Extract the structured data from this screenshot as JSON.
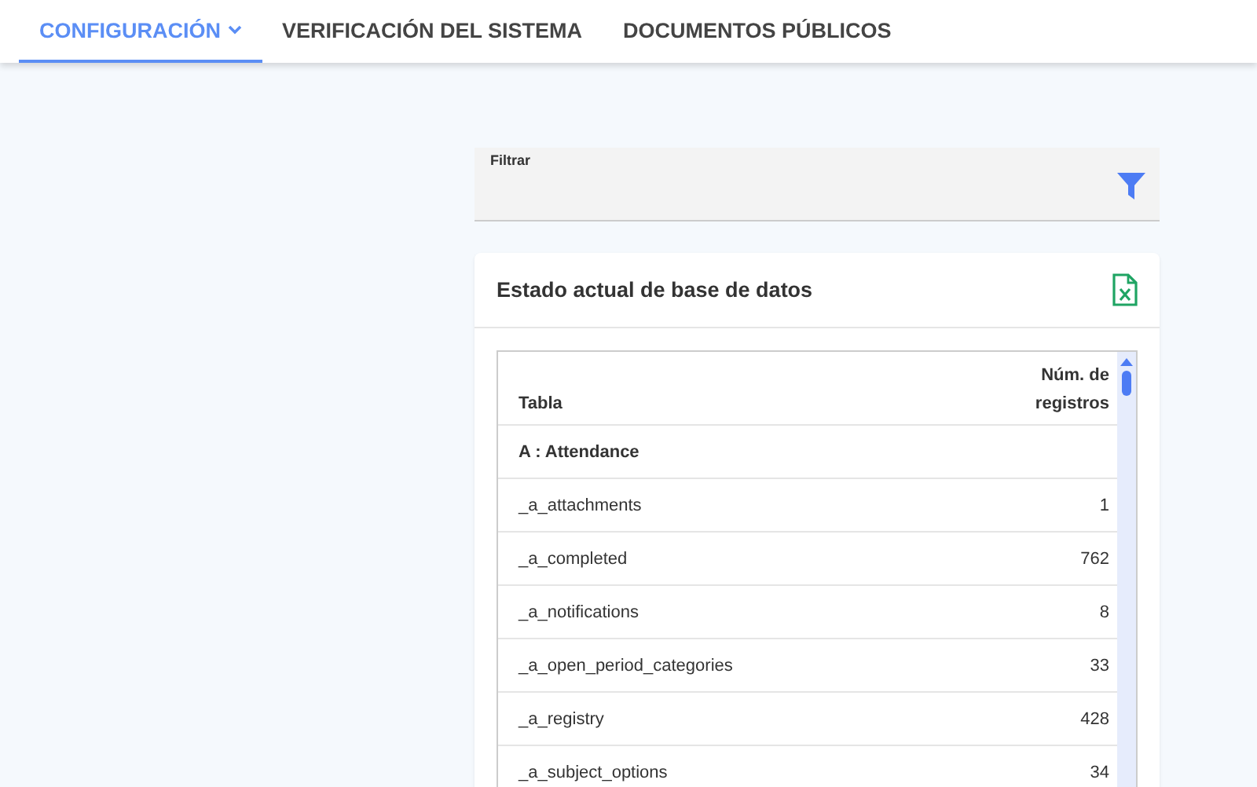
{
  "nav": {
    "tabs": [
      {
        "label": "CONFIGURACIÓN",
        "selected": true,
        "has_menu": true
      },
      {
        "label": "VERIFICACIÓN DEL SISTEMA",
        "selected": false,
        "has_menu": false
      },
      {
        "label": "DOCUMENTOS PÚBLICOS",
        "selected": false,
        "has_menu": false
      }
    ]
  },
  "filter": {
    "label": "Filtrar"
  },
  "card": {
    "title": "Estado actual de base de datos",
    "table": {
      "columns": [
        "Tabla",
        "Núm. de registros"
      ],
      "rows": [
        {
          "kind": "group",
          "name": "A : Attendance",
          "count": ""
        },
        {
          "kind": "row",
          "name": "_a_attachments",
          "count": "1"
        },
        {
          "kind": "row",
          "name": "_a_completed",
          "count": "762"
        },
        {
          "kind": "row",
          "name": "_a_notifications",
          "count": "8"
        },
        {
          "kind": "row",
          "name": "_a_open_period_categories",
          "count": "33"
        },
        {
          "kind": "row",
          "name": "_a_registry",
          "count": "428"
        },
        {
          "kind": "row",
          "name": "_a_subject_options",
          "count": "34"
        }
      ]
    }
  }
}
